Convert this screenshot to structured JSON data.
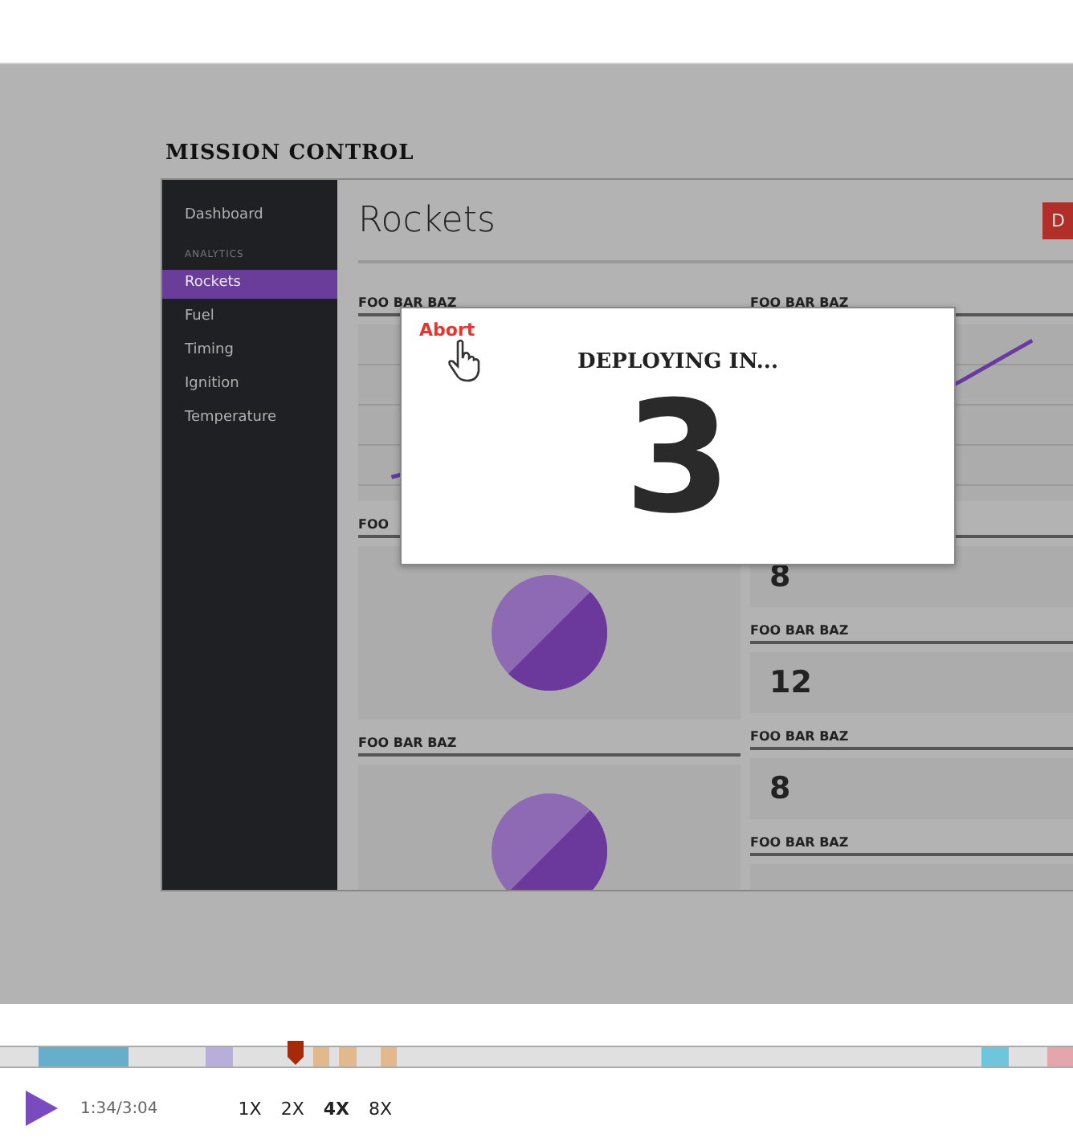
{
  "app": {
    "title": "MISSION CONTROL",
    "sidebar": {
      "items": [
        {
          "label": "Dashboard",
          "kind": "link",
          "selected": false
        },
        {
          "label": "ANALYTICS",
          "kind": "heading"
        },
        {
          "label": "Rockets",
          "kind": "link",
          "selected": true
        },
        {
          "label": "Fuel",
          "kind": "link",
          "selected": false
        },
        {
          "label": "Timing",
          "kind": "link",
          "selected": false
        },
        {
          "label": "Ignition",
          "kind": "link",
          "selected": false
        },
        {
          "label": "Temperature",
          "kind": "link",
          "selected": false
        }
      ]
    },
    "page_title": "Rockets",
    "action_button": "D",
    "left_cards": [
      {
        "label": "FOO BAR BAZ",
        "kind": "line"
      },
      {
        "label": "FOO",
        "kind": "pie"
      },
      {
        "label": "FOO BAR BAZ",
        "kind": "pie"
      }
    ],
    "right_cards": [
      {
        "label": "FOO BAR BAZ",
        "kind": "line"
      },
      {
        "kind": "value",
        "value": "8"
      },
      {
        "label": "FOO BAR BAZ",
        "kind": "value",
        "value": "12"
      },
      {
        "label": "FOO BAR BAZ",
        "kind": "value",
        "value": "8"
      },
      {
        "label": "FOO BAR BAZ",
        "kind": "value"
      }
    ]
  },
  "modal": {
    "abort": "Abort",
    "heading": "DEPLOYING IN...",
    "count": "3"
  },
  "player": {
    "level": 0.275,
    "segments": [
      {
        "color": "#67aecb"
      },
      {
        "color": "#b8aedc"
      },
      {
        "color": "#e2b98f"
      },
      {
        "color": "#e2b98f"
      },
      {
        "color": "#e2b98f"
      },
      {
        "color": "#6ec6dd"
      },
      {
        "color": "#e5a5ad"
      }
    ],
    "time": "1:34/3:04",
    "speeds": [
      {
        "label": "1X",
        "selected": false
      },
      {
        "label": "2X",
        "selected": false
      },
      {
        "label": "4X",
        "selected": true
      },
      {
        "label": "8X",
        "selected": false
      }
    ]
  }
}
